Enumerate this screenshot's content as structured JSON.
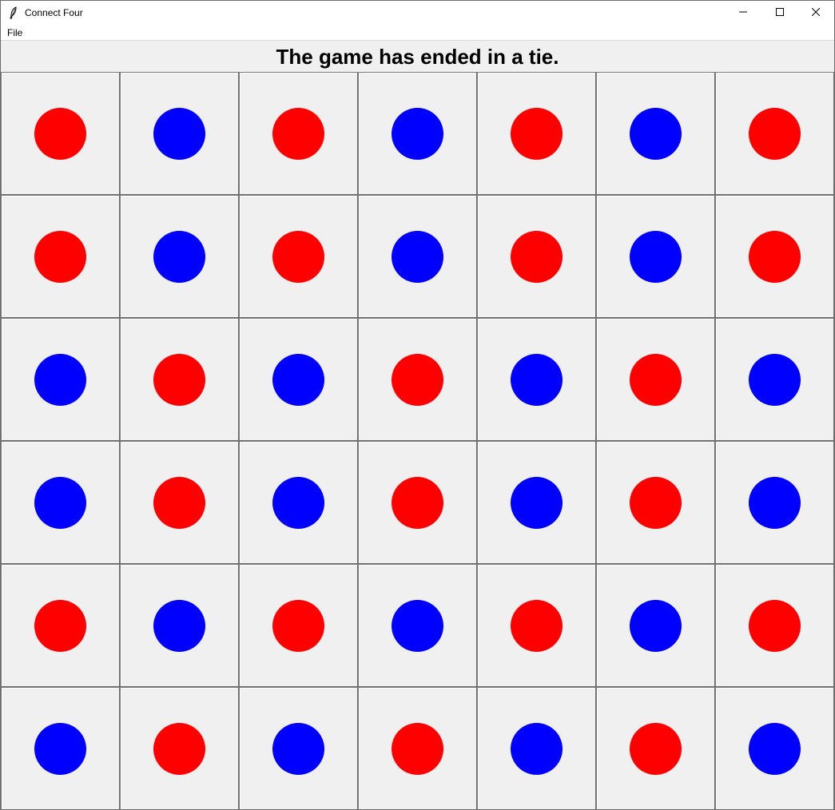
{
  "window": {
    "title": "Connect Four"
  },
  "menu": {
    "file_label": "File"
  },
  "status": {
    "message": "The game has ended in a tie."
  },
  "colors": {
    "red": "#ff0000",
    "blue": "#0000ff",
    "cell_bg": "#f0f0f0"
  },
  "board": {
    "rows": 6,
    "columns": 7,
    "cells": [
      [
        "red",
        "blue",
        "red",
        "blue",
        "red",
        "blue",
        "red"
      ],
      [
        "red",
        "blue",
        "red",
        "blue",
        "red",
        "blue",
        "red"
      ],
      [
        "blue",
        "red",
        "blue",
        "red",
        "blue",
        "red",
        "blue"
      ],
      [
        "blue",
        "red",
        "blue",
        "red",
        "blue",
        "red",
        "blue"
      ],
      [
        "red",
        "blue",
        "red",
        "blue",
        "red",
        "blue",
        "red"
      ],
      [
        "blue",
        "red",
        "blue",
        "red",
        "blue",
        "red",
        "blue"
      ]
    ]
  },
  "icons": {
    "app": "feather-icon",
    "minimize": "minimize-icon",
    "maximize": "maximize-icon",
    "close": "close-icon"
  }
}
